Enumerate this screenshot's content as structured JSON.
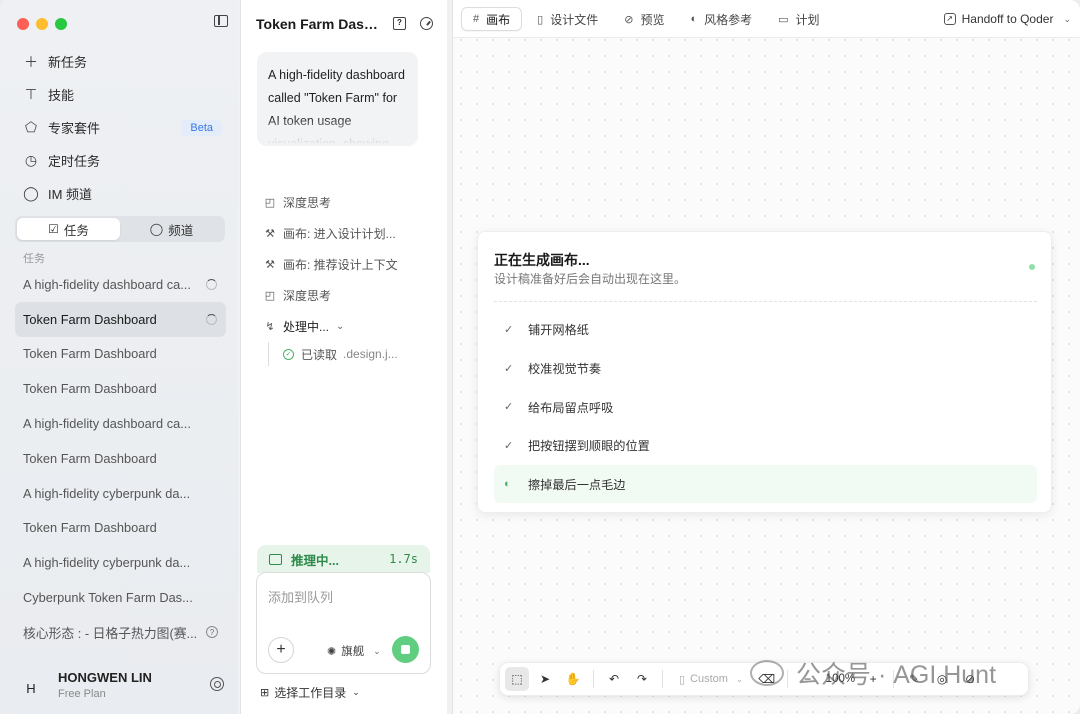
{
  "sidebar": {
    "nav": [
      {
        "icon": "plus-icon",
        "label": "新任务"
      },
      {
        "icon": "skill-icon",
        "label": "技能"
      },
      {
        "icon": "puzzle-icon",
        "label": "专家套件",
        "badge": "Beta"
      },
      {
        "icon": "clock-icon",
        "label": "定时任务"
      },
      {
        "icon": "chat-icon",
        "label": "IM 频道"
      }
    ],
    "segment": {
      "tasks": "任务",
      "channels": "频道"
    },
    "section_label": "任务",
    "tasks": [
      {
        "label": "A high-fidelity dashboard ca...",
        "status": "loading"
      },
      {
        "label": "Token Farm Dashboard",
        "status": "loading",
        "active": true
      },
      {
        "label": "Token Farm Dashboard"
      },
      {
        "label": "Token Farm Dashboard"
      },
      {
        "label": "A high-fidelity dashboard ca..."
      },
      {
        "label": "Token Farm Dashboard"
      },
      {
        "label": "A high-fidelity cyberpunk da..."
      },
      {
        "label": "Token Farm Dashboard"
      },
      {
        "label": "A high-fidelity cyberpunk da..."
      },
      {
        "label": "Cyberpunk Token Farm Das..."
      },
      {
        "label": "核心形态 : - 日格子热力图(赛...",
        "status": "help"
      }
    ],
    "user": {
      "initial": "H",
      "name": "HONGWEN LIN",
      "plan": "Free Plan"
    }
  },
  "chat": {
    "title": "Token Farm Dashb...",
    "prompt": "A high-fidelity dashboard called \"Token Farm\" for AI token usage visualization, showing Clau",
    "steps": [
      {
        "icon": "think-icon",
        "label": "深度思考"
      },
      {
        "icon": "wrench-icon",
        "label": "画布: 进入设计计划..."
      },
      {
        "icon": "wrench-icon",
        "label": "画布: 推荐设计上下文"
      },
      {
        "icon": "think-icon",
        "label": "深度思考"
      },
      {
        "icon": "process-icon",
        "label": "处理中...",
        "chevron": "⌄"
      }
    ],
    "sub_step": {
      "label": "已读取",
      "file": ".design.j..."
    },
    "reasoning": {
      "label": "推理中...",
      "time": "1.7s"
    },
    "composer": {
      "placeholder": "添加到队列",
      "model": "旗舰"
    },
    "workdir": "选择工作目录"
  },
  "canvas": {
    "tabs": [
      {
        "icon": "grid-icon",
        "label": "画布",
        "active": true
      },
      {
        "icon": "file-icon",
        "label": "设计文件"
      },
      {
        "icon": "eye-icon",
        "label": "预览"
      },
      {
        "icon": "palette-icon",
        "label": "风格参考"
      },
      {
        "icon": "clipboard-icon",
        "label": "计划"
      }
    ],
    "handoff": "Handoff to Qoder",
    "card": {
      "title": "正在生成画布...",
      "subtitle": "设计稿准备好后会自动出现在这里。",
      "items": [
        {
          "label": "铺开网格纸",
          "done": true
        },
        {
          "label": "校准视觉节奏",
          "done": true
        },
        {
          "label": "给布局留点呼吸",
          "done": true
        },
        {
          "label": "把按钮摆到顺眼的位置",
          "done": true
        },
        {
          "label": "擦掉最后一点毛边",
          "done": false
        }
      ]
    },
    "toolbar": {
      "preset": "Custom",
      "zoom": "100%"
    }
  },
  "watermark": "公众号 · AGI Hunt",
  "colors": {
    "accent_green": "#5fce80",
    "beta_blue": "#3a78e0"
  }
}
